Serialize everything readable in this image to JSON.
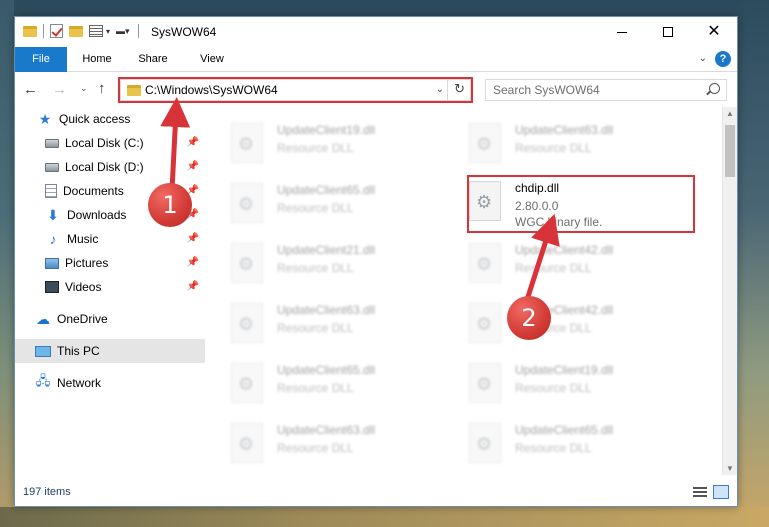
{
  "window": {
    "title": "SysWOW64"
  },
  "ribbon": {
    "tabs": [
      "File",
      "Home",
      "Share",
      "View"
    ],
    "help": "?"
  },
  "navigation": {
    "address": "C:\\Windows\\SysWOW64",
    "search_placeholder": "Search SysWOW64"
  },
  "sidebar": {
    "items": [
      {
        "label": "Quick access",
        "icon": "star-icon"
      },
      {
        "label": "Local Disk (C:)",
        "icon": "disk-icon",
        "pinned": true
      },
      {
        "label": "Local Disk (D:)",
        "icon": "disk-icon",
        "pinned": true
      },
      {
        "label": "Documents",
        "icon": "documents-icon",
        "pinned": true
      },
      {
        "label": "Downloads",
        "icon": "download-icon",
        "pinned": true
      },
      {
        "label": "Music",
        "icon": "music-icon",
        "pinned": true
      },
      {
        "label": "Pictures",
        "icon": "pictures-icon",
        "pinned": true
      },
      {
        "label": "Videos",
        "icon": "videos-icon",
        "pinned": true
      },
      {
        "label": "OneDrive",
        "icon": "cloud-icon"
      },
      {
        "label": "This PC",
        "icon": "computer-icon",
        "selected": true
      },
      {
        "label": "Network",
        "icon": "network-icon"
      }
    ]
  },
  "files": {
    "col1": [
      {
        "name": "UpdateClient19.dll",
        "desc": "Resource DLL"
      },
      {
        "name": "UpdateClient65.dll",
        "desc": "Resource DLL"
      },
      {
        "name": "UpdateClient21.dll",
        "desc": "Resource DLL"
      },
      {
        "name": "UpdateClient63.dll",
        "desc": "Resource DLL"
      },
      {
        "name": "UpdateClient65.dll",
        "desc": "Resource DLL"
      },
      {
        "name": "UpdateClient63.dll",
        "desc": "Resource DLL"
      }
    ],
    "col2": [
      {
        "name": "UpdateClient63.dll",
        "desc": "Resource DLL"
      },
      {
        "name": "UpdateClient42.dll",
        "desc": "Resource DLL"
      },
      {
        "name": "UpdateClient42.dll",
        "desc": "Resource DLL"
      },
      {
        "name": "UpdateClient19.dll",
        "desc": "Resource DLL"
      },
      {
        "name": "UpdateClient65.dll",
        "desc": "Resource DLL"
      }
    ],
    "featured": {
      "name": "chdip.dll",
      "version": "2.80.0.0",
      "desc": "WGC binary file."
    }
  },
  "status": {
    "item_count": "197 items"
  },
  "callouts": {
    "one": "1",
    "two": "2"
  },
  "colors": {
    "accent": "#1979ca",
    "highlight": "#d9333a"
  }
}
